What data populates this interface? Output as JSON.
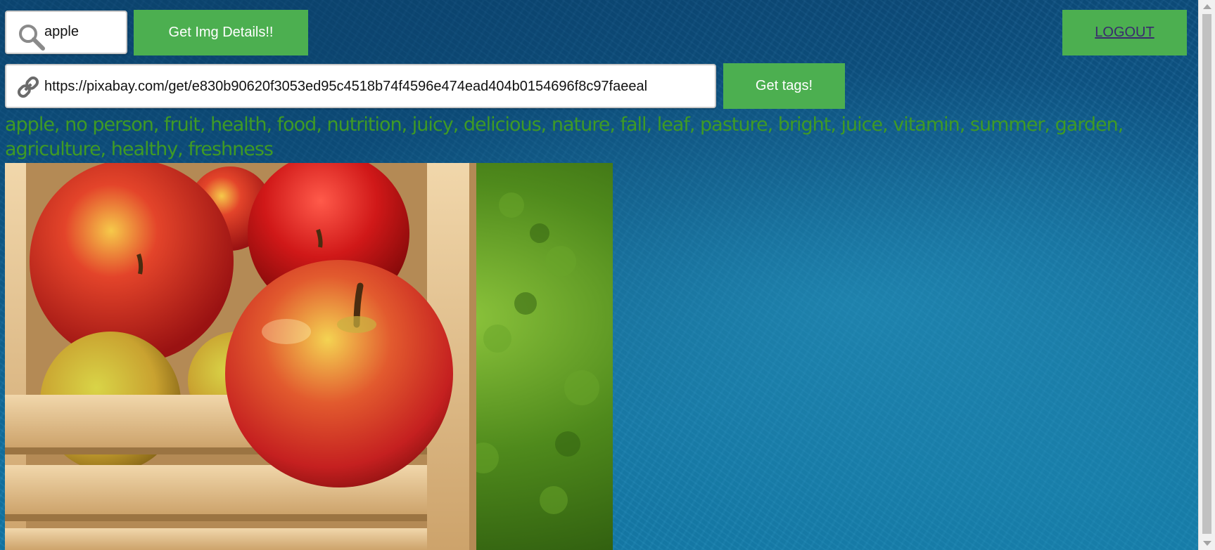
{
  "search": {
    "value": "apple",
    "icon": "search-icon"
  },
  "buttons": {
    "img_details": "Get Img Details!!",
    "logout": "LOGOUT",
    "get_tags": "Get tags!"
  },
  "url_input": {
    "value": "https://pixabay.com/get/e830b90620f3053ed95c4518b74f4596e474ead404b0154696f8c97faeeal",
    "icon": "link-icon"
  },
  "tags_text": "apple, no person, fruit, health, food, nutrition, juicy, delicious, nature, fall, leaf, pasture, bright, juice, vitamin, summer, garden, agriculture, healthy, freshness",
  "colors": {
    "button_green": "#4caf50",
    "tag_text": "#3f9a25",
    "background_blue": "#11679a"
  }
}
